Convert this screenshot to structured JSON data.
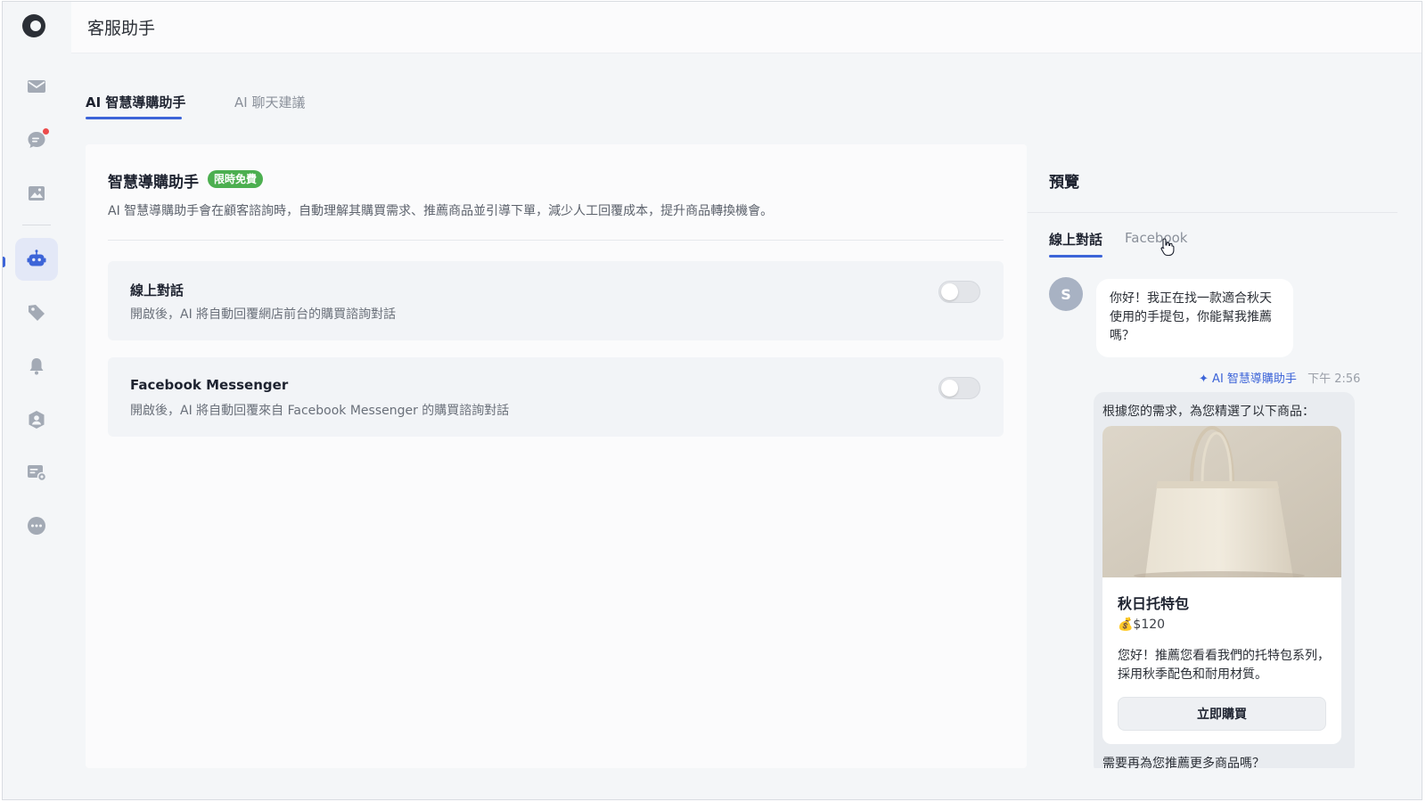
{
  "header": {
    "title": "客服助手"
  },
  "sidebar": {
    "items": [
      {
        "icon": "mail-icon"
      },
      {
        "icon": "chat-icon",
        "has_notification": true
      },
      {
        "icon": "image-icon"
      },
      {
        "icon": "bot-icon",
        "active": true
      },
      {
        "icon": "tag-icon"
      },
      {
        "icon": "bell-icon"
      },
      {
        "icon": "user-shield-icon"
      },
      {
        "icon": "card-settings-icon"
      },
      {
        "icon": "more-icon"
      }
    ]
  },
  "tabs": [
    {
      "label": "AI 智慧導購助手",
      "active": true
    },
    {
      "label": "AI 聊天建議",
      "active": false
    }
  ],
  "main": {
    "title": "智慧導購助手",
    "badge": "限時免費",
    "description": "AI 智慧導購助手會在顧客諮詢時，自動理解其購買需求、推薦商品並引導下單，減少人工回覆成本，提升商品轉換機會。",
    "settings": [
      {
        "title": "線上對話",
        "description": "開啟後，AI 將自動回覆網店前台的購買諮詢對話",
        "enabled": false
      },
      {
        "title": "Facebook Messenger",
        "description": "開啟後，AI 將自動回覆來自 Facebook Messenger 的購買諮詢對話",
        "enabled": false
      }
    ]
  },
  "preview": {
    "title": "預覽",
    "tabs": [
      {
        "label": "線上對話",
        "active": true
      },
      {
        "label": "Facebook",
        "active": false
      }
    ],
    "user": {
      "avatar": "S",
      "message": "你好！我正在找一款適合秋天使用的手提包，你能幫我推薦嗎？"
    },
    "ai": {
      "sparkle": "✦",
      "name": "AI 智慧導購助手",
      "time": "下午 2:56",
      "intro": "根據您的需求，為您精選了以下商品：",
      "product": {
        "name": "秋日托特包",
        "price": "💰$120",
        "description": "您好！推薦您看看我們的托特包系列，採用秋季配色和耐用材質。",
        "button": "立即購買"
      },
      "followup": "需要再為您推薦更多商品嗎？"
    }
  },
  "colors": {
    "accent": "#3c64d8",
    "badge_green": "#4caf50",
    "notification_red": "#ec4b4b"
  }
}
